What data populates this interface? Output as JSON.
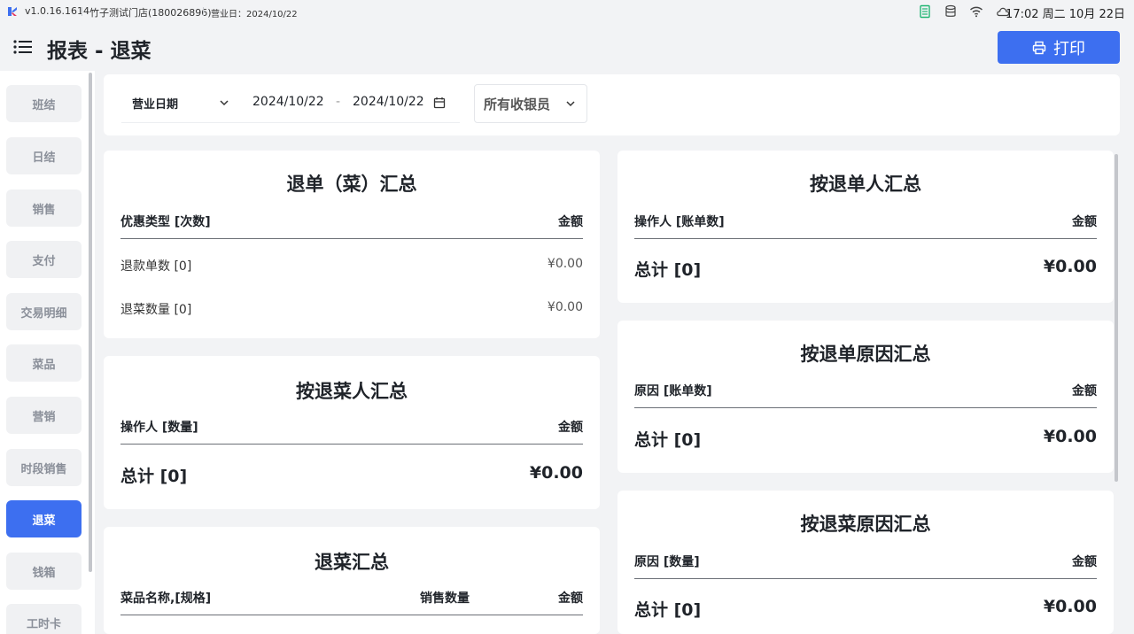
{
  "status": {
    "version": "v1.0.16.1614",
    "store": "竹子测试门店(180026896)",
    "business_day": "营业日：2024/10/22",
    "time": "17:02 周二 10月 22日"
  },
  "header": {
    "title": "报表 - 退菜",
    "print_label": "打印"
  },
  "colors": {
    "accent": "#3d6ff0"
  },
  "sidebar": {
    "items": [
      {
        "label": "班结"
      },
      {
        "label": "日结"
      },
      {
        "label": "销售"
      },
      {
        "label": "支付"
      },
      {
        "label": "交易明细"
      },
      {
        "label": "菜品"
      },
      {
        "label": "营销"
      },
      {
        "label": "时段销售"
      },
      {
        "label": "退菜",
        "active": true
      },
      {
        "label": "钱箱"
      },
      {
        "label": "工时卡"
      }
    ]
  },
  "filters": {
    "date_type": "营业日期",
    "date_start": "2024/10/22",
    "date_sep": "-",
    "date_end": "2024/10/22",
    "cashier": "所有收银员"
  },
  "cards": {
    "refund_summary": {
      "title": "退单（菜）汇总",
      "col_left": "优惠类型 [次数]",
      "col_right": "金额",
      "rows": [
        {
          "label": "退款单数 [0]",
          "amount": "¥0.00"
        },
        {
          "label": "退菜数量 [0]",
          "amount": "¥0.00"
        }
      ]
    },
    "by_refund_person": {
      "title": "按退单人汇总",
      "col_left": "操作人 [账单数]",
      "col_right": "金额",
      "total_label": "总计 [0]",
      "total_amount": "¥0.00"
    },
    "by_dish_person": {
      "title": "按退菜人汇总",
      "col_left": "操作人 [数量]",
      "col_right": "金额",
      "total_label": "总计 [0]",
      "total_amount": "¥0.00"
    },
    "by_refund_reason": {
      "title": "按退单原因汇总",
      "col_left": "原因 [账单数]",
      "col_right": "金额",
      "total_label": "总计 [0]",
      "total_amount": "¥0.00"
    },
    "dish_summary": {
      "title": "退菜汇总",
      "col_left": "菜品名称,[规格]",
      "col_mid": "销售数量",
      "col_right": "金额"
    },
    "by_dish_reason": {
      "title": "按退菜原因汇总",
      "col_left": "原因 [数量]",
      "col_right": "金额",
      "total_label": "总计 [0]",
      "total_amount": "¥0.00"
    }
  }
}
